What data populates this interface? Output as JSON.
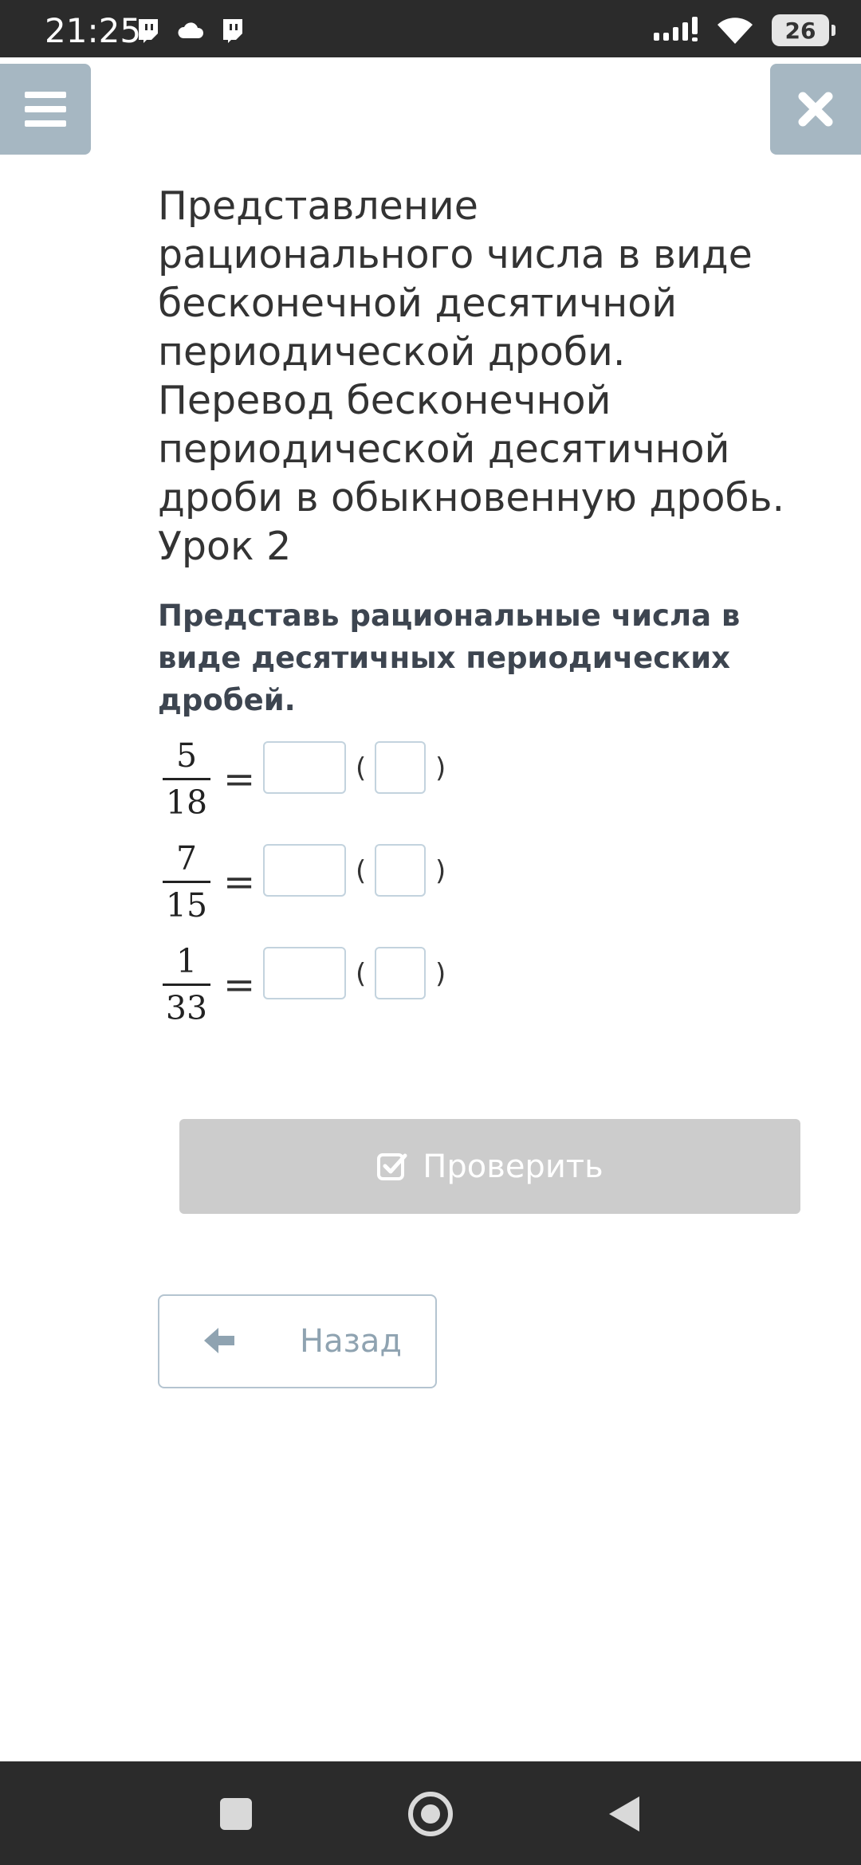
{
  "status_bar": {
    "time": "21:25",
    "battery": "26",
    "left_icons": [
      "twitch-icon",
      "cloud-icon",
      "twitch-icon"
    ],
    "right_icons": [
      "signal-icon",
      "wifi-icon",
      "battery-icon"
    ]
  },
  "header": {
    "menu_icon": "hamburger-menu-icon",
    "close_icon": "close-icon",
    "lesson_title": "Представление рационального числа в виде бесконечной десятичной периодической дроби. Перевод бесконечной периодической десятичной дроби в обыкновенную дробь. Урок 2"
  },
  "task": {
    "instruction": "Представь рациональные числа в виде десятичных периодических дробей.",
    "rows": [
      {
        "numerator": "5",
        "denominator": "18",
        "equals": "=",
        "open_paren": "(",
        "close_paren": ")",
        "value": "",
        "period": ""
      },
      {
        "numerator": "7",
        "denominator": "15",
        "equals": "=",
        "open_paren": "(",
        "close_paren": ")",
        "value": "",
        "period": ""
      },
      {
        "numerator": "1",
        "denominator": "33",
        "equals": "=",
        "open_paren": "(",
        "close_paren": ")",
        "value": "",
        "period": ""
      }
    ]
  },
  "actions": {
    "check_label": "Проверить",
    "check_icon": "checkbox-check-icon",
    "back_label": "Назад",
    "back_icon": "arrow-left-icon"
  },
  "colors": {
    "status_bar_bg": "#2b2b2b",
    "top_button_bg": "#a6b7c2",
    "check_button_bg": "#cccccc",
    "input_border": "#c3d3de",
    "back_text": "#8fa3b1"
  }
}
